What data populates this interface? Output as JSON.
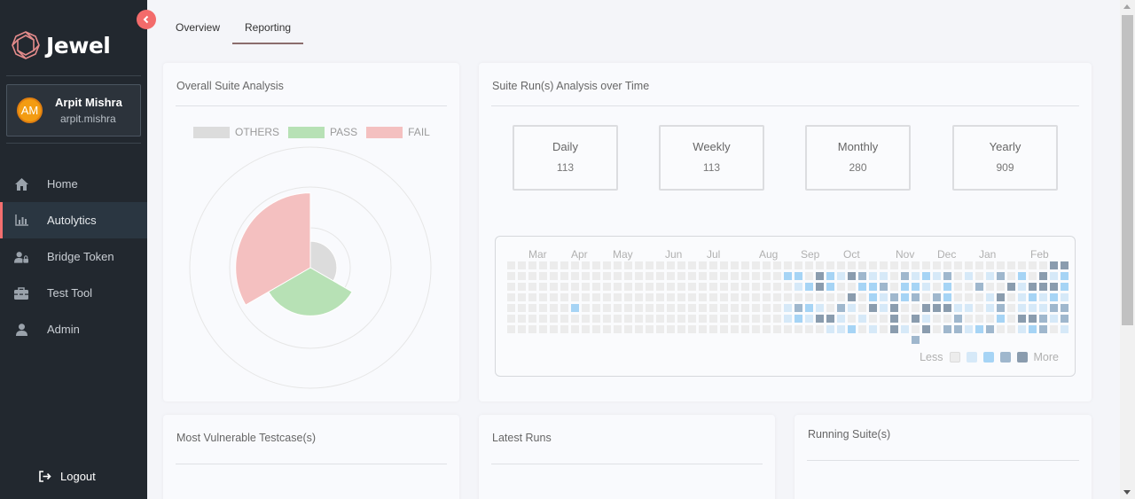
{
  "brand": {
    "name": "Jewel"
  },
  "user": {
    "initials": "AM",
    "name": "Arpit Mishra",
    "handle": "arpit.mishra"
  },
  "nav": [
    {
      "label": "Home",
      "icon": "home-icon"
    },
    {
      "label": "Autolytics",
      "icon": "bar-chart-icon",
      "active": true
    },
    {
      "label": "Bridge Token",
      "icon": "user-lock-icon"
    },
    {
      "label": "Test Tool",
      "icon": "toolbox-icon"
    },
    {
      "label": "Admin",
      "icon": "user-icon"
    }
  ],
  "logout": {
    "label": "Logout",
    "icon": "sign-out-icon"
  },
  "tabs": [
    {
      "label": "Overview"
    },
    {
      "label": "Reporting",
      "active": true
    }
  ],
  "suite_analysis": {
    "title": "Overall Suite Analysis",
    "legend": [
      {
        "label": "OTHERS",
        "color": "#dcdcdc"
      },
      {
        "label": "PASS",
        "color": "#b7e1b5"
      },
      {
        "label": "FAIL",
        "color": "#f4c0c0"
      }
    ]
  },
  "chart_data": {
    "type": "polar-area",
    "categories": [
      "OTHERS",
      "PASS",
      "FAIL"
    ],
    "colors": [
      "#dcdcdc",
      "#b7e1b5",
      "#f4c0c0"
    ],
    "values": [
      0.22,
      0.4,
      0.62
    ]
  },
  "runs_over_time": {
    "title": "Suite Run(s) Analysis over Time",
    "stats": [
      {
        "label": "Daily",
        "value": "113"
      },
      {
        "label": "Weekly",
        "value": "113"
      },
      {
        "label": "Monthly",
        "value": "280"
      },
      {
        "label": "Yearly",
        "value": "909"
      }
    ],
    "months": [
      "Mar",
      "Apr",
      "May",
      "Jun",
      "Jul",
      "Aug",
      "Sep",
      "Oct",
      "Nov",
      "Dec",
      "Jan",
      "Feb"
    ],
    "legend_less": "Less",
    "legend_more": "More",
    "legend_colors": [
      "#ececec",
      "#d6e9f8",
      "#a6d4f5",
      "#9fb7cd",
      "#8a9cae"
    ]
  },
  "vulnerable": {
    "title": "Most Vulnerable Testcase(s)"
  },
  "latest_runs": {
    "title": "Latest Runs"
  },
  "running_suites": {
    "title": "Running Suite(s)"
  }
}
